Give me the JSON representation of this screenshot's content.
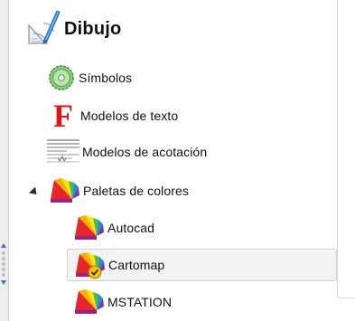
{
  "tree": {
    "root": {
      "label": "Dibujo",
      "icon": "drawing-tools-icon"
    },
    "items": [
      {
        "label": "Símbolos",
        "icon": "symbol-circle-icon",
        "color": "#4caf50"
      },
      {
        "label": "Modelos de texto",
        "icon": "font-f-icon",
        "color": "#e11818"
      },
      {
        "label": "Modelos de acotación",
        "icon": "dimension-lines-icon"
      },
      {
        "label": "Paletas de colores",
        "icon": "color-palette-icon",
        "expanded": true,
        "children": [
          {
            "label": "Autocad",
            "icon": "color-palette-icon"
          },
          {
            "label": "Cartomap",
            "icon": "color-palette-check-icon",
            "selected": true
          },
          {
            "label": "MSTATION",
            "icon": "color-palette-icon"
          }
        ]
      }
    ]
  },
  "colors": {
    "selection_bg": "#f3f3f3",
    "selection_border": "#d2d2d2",
    "splitter_arrow": "#3a6fd1"
  }
}
